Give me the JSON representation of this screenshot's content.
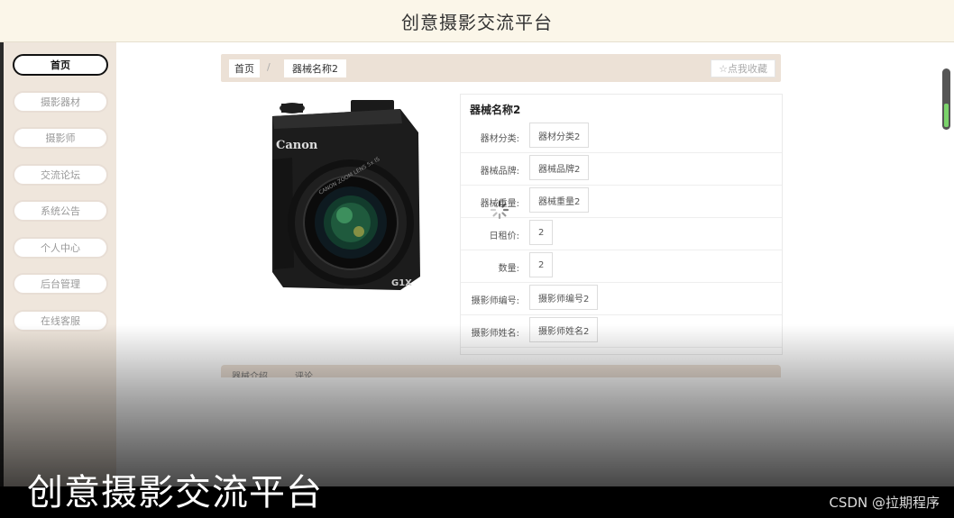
{
  "header": {
    "title": "创意摄影交流平台"
  },
  "sidebar": {
    "items": [
      {
        "label": "首页",
        "active": true
      },
      {
        "label": "摄影器材",
        "active": false
      },
      {
        "label": "摄影师",
        "active": false
      },
      {
        "label": "交流论坛",
        "active": false
      },
      {
        "label": "系统公告",
        "active": false
      },
      {
        "label": "个人中心",
        "active": false
      },
      {
        "label": "后台管理",
        "active": false
      },
      {
        "label": "在线客服",
        "active": false
      }
    ]
  },
  "breadcrumb": {
    "home": "首页",
    "separator": "/",
    "current": "器械名称2",
    "collect_button": "☆点我收藏"
  },
  "product": {
    "image_label": "Canon G1X camera",
    "name": "器械名称2",
    "fields": [
      {
        "label": "器材分类:",
        "value": "器材分类2"
      },
      {
        "label": "器械品牌:",
        "value": "器械品牌2"
      },
      {
        "label": "器械重量:",
        "value": "器械重量2"
      },
      {
        "label": "日租价:",
        "value": "2"
      },
      {
        "label": "数量:",
        "value": "2"
      },
      {
        "label": "摄影师编号:",
        "value": "摄影师编号2"
      },
      {
        "label": "摄影师姓名:",
        "value": "摄影师姓名2"
      }
    ]
  },
  "tabs": [
    {
      "label": "器械介绍"
    },
    {
      "label": "评论"
    }
  ],
  "overlay": {
    "caption": "创意摄影交流平台",
    "watermark": "CSDN @拉期程序"
  },
  "colors": {
    "header_bg": "#fbf6e9",
    "sidebar_bg": "#efe6dc",
    "breadcrumb_bg": "#ece1d6",
    "scroll_accent": "#7bd36b"
  }
}
